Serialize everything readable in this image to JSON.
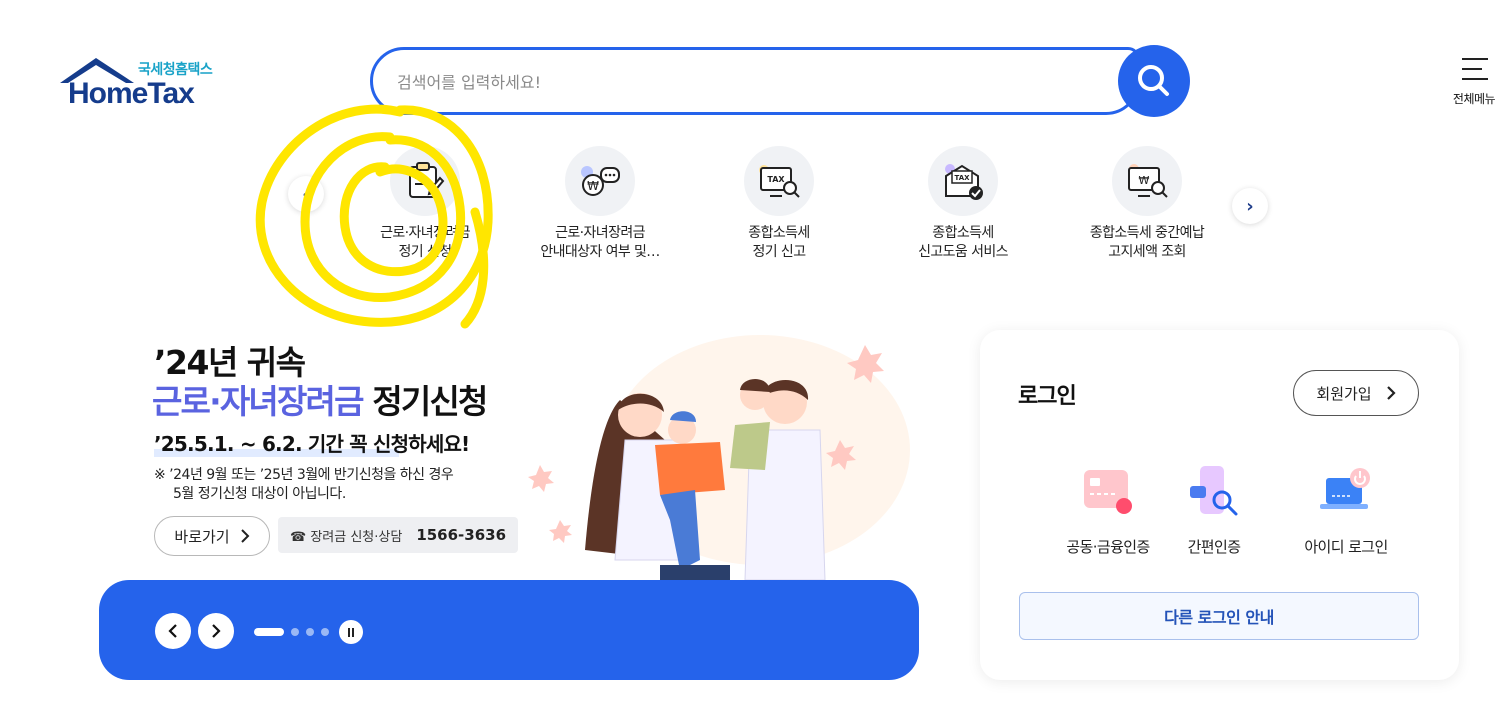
{
  "header": {
    "logo_sub": "국세청홈택스",
    "logo_main": "HomeTax",
    "search_placeholder": "검색어를 입력하세요!",
    "menu_label": "전체메뉴"
  },
  "quick_services": [
    {
      "line1": "근로·자녀장려금",
      "line2": "정기 신청",
      "icon": "document-pen-icon"
    },
    {
      "line1": "근로·자녀장려금",
      "line2": "안내대상자 여부 및…",
      "icon": "won-chat-icon"
    },
    {
      "line1": "종합소득세",
      "line2": "정기 신고",
      "icon": "tax-monitor-search-icon"
    },
    {
      "line1": "종합소득세",
      "line2": "신고도움 서비스",
      "icon": "tax-envelope-check-icon"
    },
    {
      "line1": "종합소득세 중간예납",
      "line2": "고지세액 조회",
      "icon": "won-monitor-search-icon"
    }
  ],
  "banner": {
    "title1": "’24년 귀속",
    "title2_accent": "근로·자녀장려금",
    "title2_rest": " 정기신청",
    "date_line": "’25.5.1. ~ 6.2. 기간 꼭 신청하세요!",
    "note_line1": "※ ’24년 9월 또는 ’25년 3월에 반기신청을 하신 경우",
    "note_line2": "5월 정기신청 대상이 아닙니다.",
    "go_button": "바로가기",
    "phone_label": "☎ 장려금 신청·상담",
    "phone_number": "1566-3636",
    "slide_count": 4,
    "active_slide": 1
  },
  "login": {
    "title": "로그인",
    "join_button": "회원가입",
    "options": [
      {
        "label": "공동·금융인증",
        "icon": "certificate-card-icon"
      },
      {
        "label": "간편인증",
        "icon": "mobile-search-icon"
      },
      {
        "label": "아이디 로그인",
        "icon": "laptop-power-icon"
      }
    ],
    "other_login": "다른 로그인 안내"
  },
  "colors": {
    "primary": "#2563eb",
    "accent_purple": "#5a63e0",
    "logo_blue": "#153c8c",
    "logo_cyan": "#1aa3c8",
    "highlight_yellow": "#ffe600"
  }
}
